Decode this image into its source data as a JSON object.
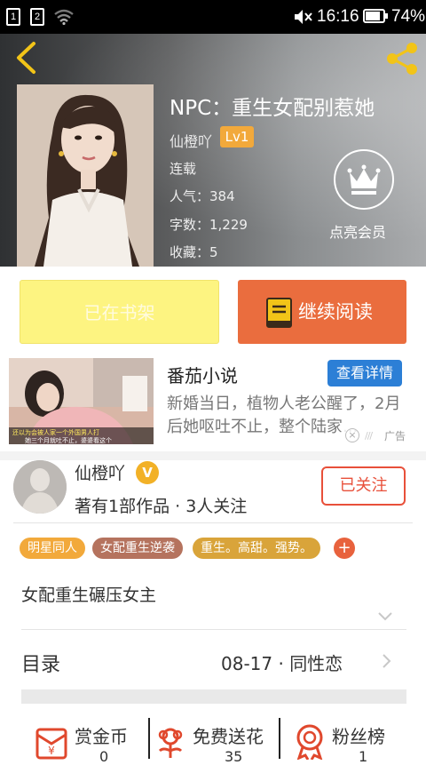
{
  "status_bar": {
    "sim1": "1",
    "sim2": "2",
    "time": "16:16",
    "battery": "74%"
  },
  "book": {
    "title": "NPC：重生女配别惹她",
    "author": "仙橙吖",
    "level": "Lv1",
    "status": "连载",
    "popularity": "人气：384",
    "word_count": "字数：1,229",
    "favorites": "收藏：5",
    "vip_label": "点亮会员"
  },
  "actions": {
    "shelf_label": "已在书架",
    "read_label": "继续阅读"
  },
  "ad": {
    "title": "番茄小说",
    "button": "查看详情",
    "description": "新婚当日，植物人老公醒了，2月后她呕吐不止，整个陆家...",
    "badge": "广告",
    "image_caption_1": "还以为会被人家一个外国男人打",
    "image_caption_2": "她三个月就吐不止，婆婆看这个"
  },
  "author_section": {
    "name": "仙橙吖",
    "verified_badge": "V",
    "stats": "著有1部作品 · 3人关注",
    "follow_label": "已关注"
  },
  "tags": [
    "明星同人",
    "女配重生逆袭",
    "重生。高甜。强势。"
  ],
  "tag_colors": [
    "#f2a93b",
    "#b5735e",
    "#d9a43a"
  ],
  "tag_add": "+",
  "summary": "女配重生碾压女主",
  "toc": {
    "label": "目录",
    "info": "08-17 · 同性恋"
  },
  "bottom_bar": {
    "reward": {
      "label": "赏金币",
      "count": "0"
    },
    "flowers": {
      "label": "免费送花",
      "count": "35"
    },
    "fans": {
      "label": "粉丝榜",
      "count": "1"
    }
  },
  "colors": {
    "accent_orange": "#ea6d3e",
    "shelf_yellow": "#fdf481",
    "follow_red": "#e8503a",
    "ad_blue": "#2c7fd6",
    "share_icon": "#f2c418"
  }
}
